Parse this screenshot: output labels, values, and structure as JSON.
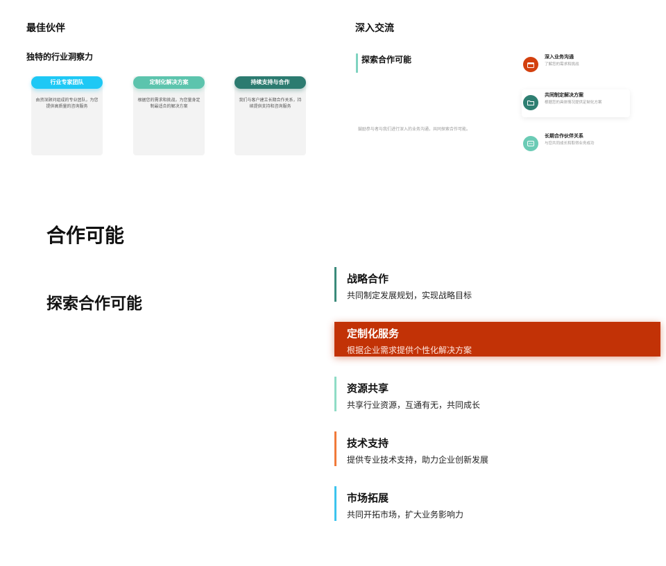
{
  "top_left": {
    "title": "最佳伙伴",
    "subtitle": "独特的行业洞察力",
    "cards": [
      {
        "label": "行业专家团队",
        "desc": "由资深顾问组成的专业团队，为您提供高质量的咨询服务",
        "color": "#1ec8f5"
      },
      {
        "label": "定制化解决方案",
        "desc": "根据您的需求和挑战，为您量身定制最适合的解决方案",
        "color": "#5cc4ad"
      },
      {
        "label": "持续支持与合作",
        "desc": "我们与客户建立长期合作关系，持续提供支持和咨询服务",
        "color": "#2c7b70"
      }
    ]
  },
  "top_right": {
    "title": "深入交流",
    "subtitle": "探索合作可能",
    "note": "鼓励参与者与我们进行深入的业务沟通，共同探索合作可能。",
    "features": [
      {
        "title": "深入业务沟通",
        "desc": "了解您的需求和挑战",
        "icon": "calendar-icon",
        "color": "#d3400e"
      },
      {
        "title": "共同制定解决方案",
        "desc": "根据您的具体情况提供定制化方案",
        "icon": "folder-icon",
        "color": "#2f7f72"
      },
      {
        "title": "长期合作伙伴关系",
        "desc": "与您共同成长和取得业务成功",
        "icon": "chat-icon",
        "color": "#6bcbb5"
      }
    ]
  },
  "bottom": {
    "title": "合作可能",
    "subtitle": "探索合作可能",
    "items": [
      {
        "title": "战略合作",
        "desc": "共同制定发展规划，实现战略目标",
        "bar_color": "#3a8a7a",
        "active": false
      },
      {
        "title": "定制化服务",
        "desc": "根据企业需求提供个性化解决方案",
        "bar_color": "#c23206",
        "active": true
      },
      {
        "title": "资源共享",
        "desc": "共享行业资源，互通有无，共同成长",
        "bar_color": "#8fdcc6",
        "active": false
      },
      {
        "title": "技术支持",
        "desc": "提供专业技术支持，助力企业创新发展",
        "bar_color": "#f07a3a",
        "active": false
      },
      {
        "title": "市场拓展",
        "desc": "共同开拓市场，扩大业务影响力",
        "bar_color": "#3cc4ee",
        "active": false
      }
    ]
  }
}
